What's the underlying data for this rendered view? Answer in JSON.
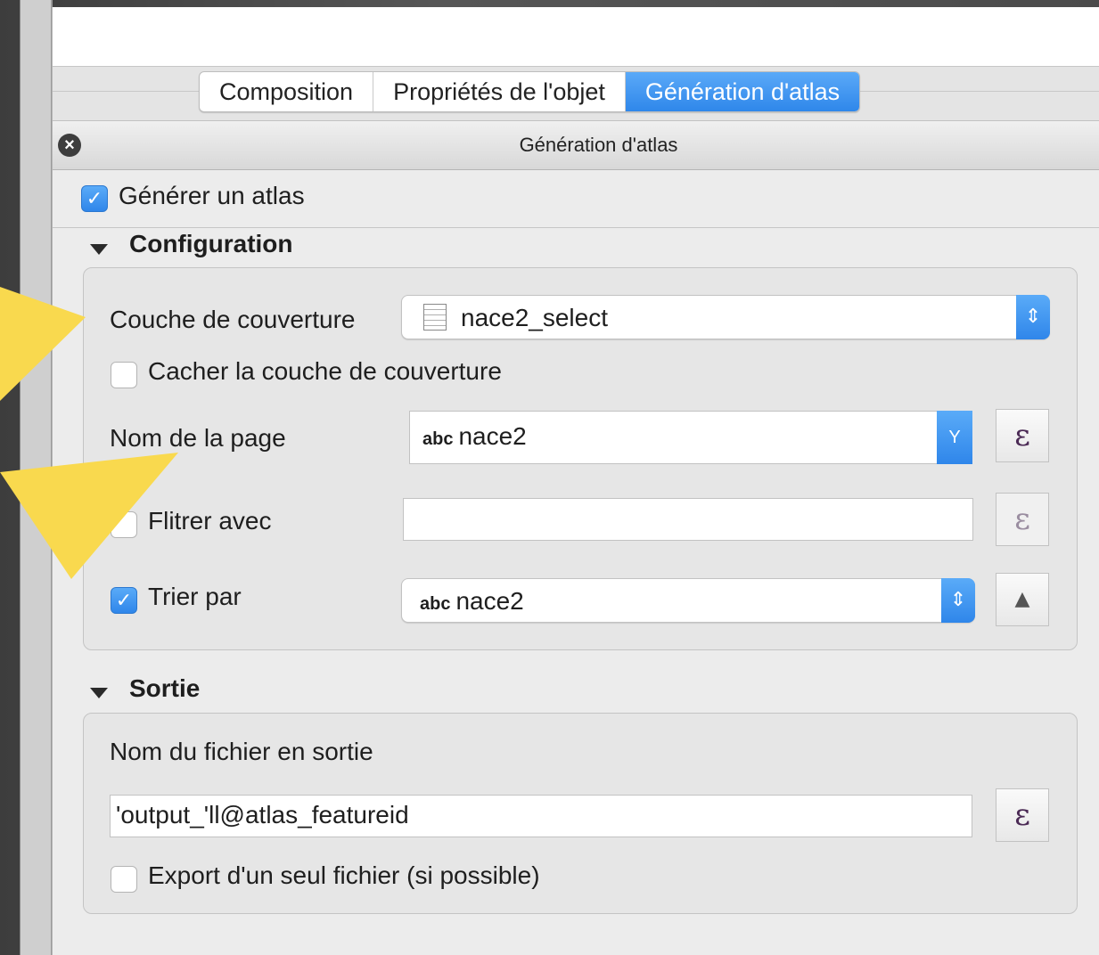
{
  "tabs": [
    {
      "label": "Composition"
    },
    {
      "label": "Propriétés de l'objet"
    },
    {
      "label": "Génération d'atlas"
    }
  ],
  "dock": {
    "title": "Génération d'atlas",
    "close_icon": "close-icon"
  },
  "generate": {
    "label": "Générer un atlas",
    "checked": true
  },
  "configuration": {
    "title": "Configuration",
    "coverage": {
      "label": "Couche de couverture",
      "value": "nace2_select",
      "icon": "table-layer-icon"
    },
    "hide_coverage": {
      "label": "Cacher la couche de couverture",
      "checked": false
    },
    "page_name": {
      "label": "Nom de la page",
      "prefix": "abc",
      "value": "nace2",
      "dropdown_glyph": "Y"
    },
    "filter": {
      "label": "Flitrer avec",
      "checked": false,
      "value": ""
    },
    "sort": {
      "label": "Trier par",
      "checked": true,
      "prefix": "abc",
      "value": "nace2",
      "order_glyph": "▲"
    }
  },
  "output": {
    "title": "Sortie",
    "filename_label": "Nom du fichier en sortie",
    "filename_value": "'output_'ll@atlas_featureid",
    "single_file": {
      "label": "Export d'un seul fichier (si possible)",
      "checked": false
    }
  },
  "expression_glyph": "ε",
  "check_glyph": "✓",
  "colors": {
    "accent": "#3a8ff0",
    "highlight_arrow": "#f9d94e"
  }
}
